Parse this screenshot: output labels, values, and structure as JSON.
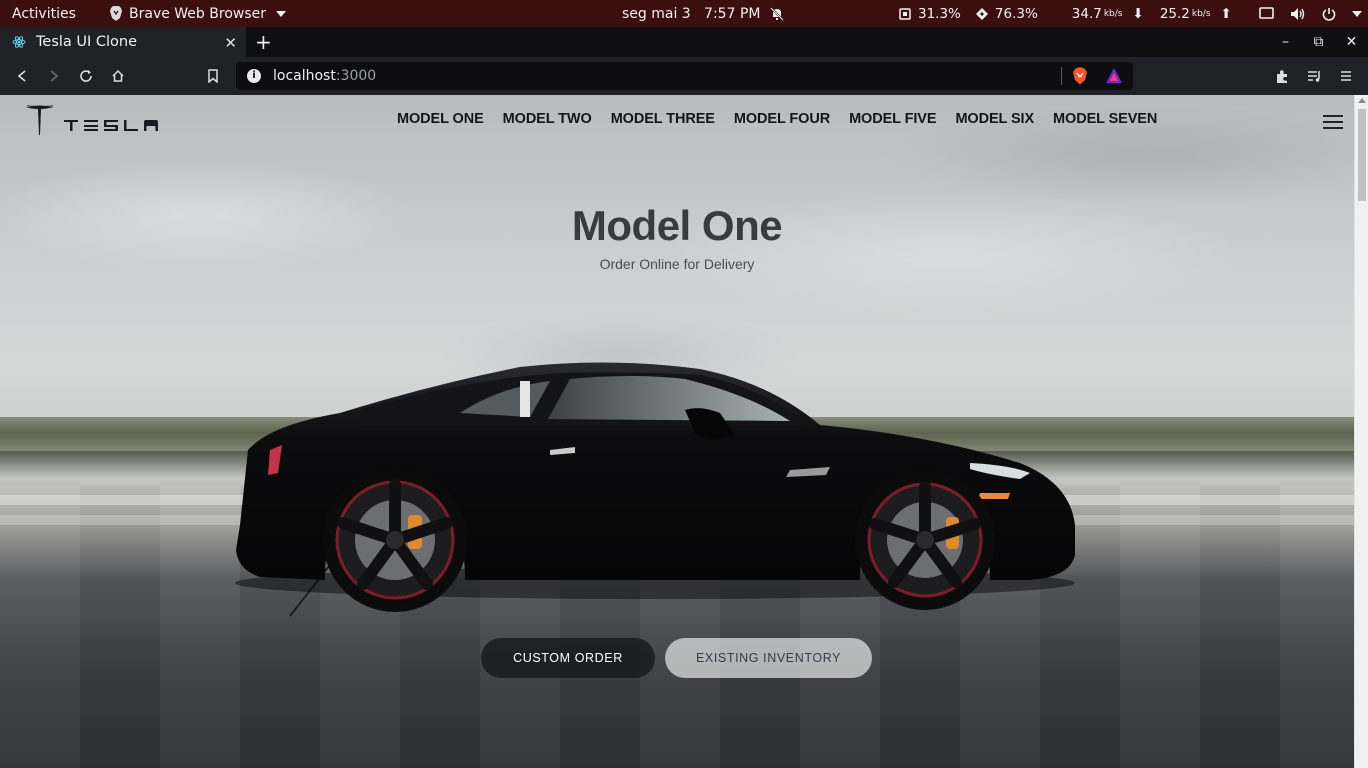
{
  "os_topbar": {
    "activities": "Activities",
    "app_name": "Brave Web Browser",
    "clock": "seg mai 3   7:57 PM",
    "cpu": "31.3%",
    "memory": "76.3%",
    "download_rate": "34.7",
    "download_unit": "kb/s",
    "upload_rate": "25.2",
    "upload_unit": "kb/s"
  },
  "browser": {
    "tab_title": "Tesla UI Clone",
    "new_tab": "+",
    "url_host": "localhost",
    "url_port": ":3000"
  },
  "site": {
    "nav": [
      "MODEL ONE",
      "MODEL TWO",
      "MODEL THREE",
      "MODEL FOUR",
      "MODEL FIVE",
      "MODEL SIX",
      "MODEL SEVEN"
    ],
    "hero_title": "Model One",
    "hero_subtitle": "Order Online for Delivery",
    "primary_button": "CUSTOM ORDER",
    "secondary_button": "EXISTING INVENTORY"
  },
  "colors": {
    "os_bar": "#3c0f0f",
    "browser_chrome": "#202126",
    "button_dark": "#171a20",
    "button_light": "#f4f4f4"
  }
}
